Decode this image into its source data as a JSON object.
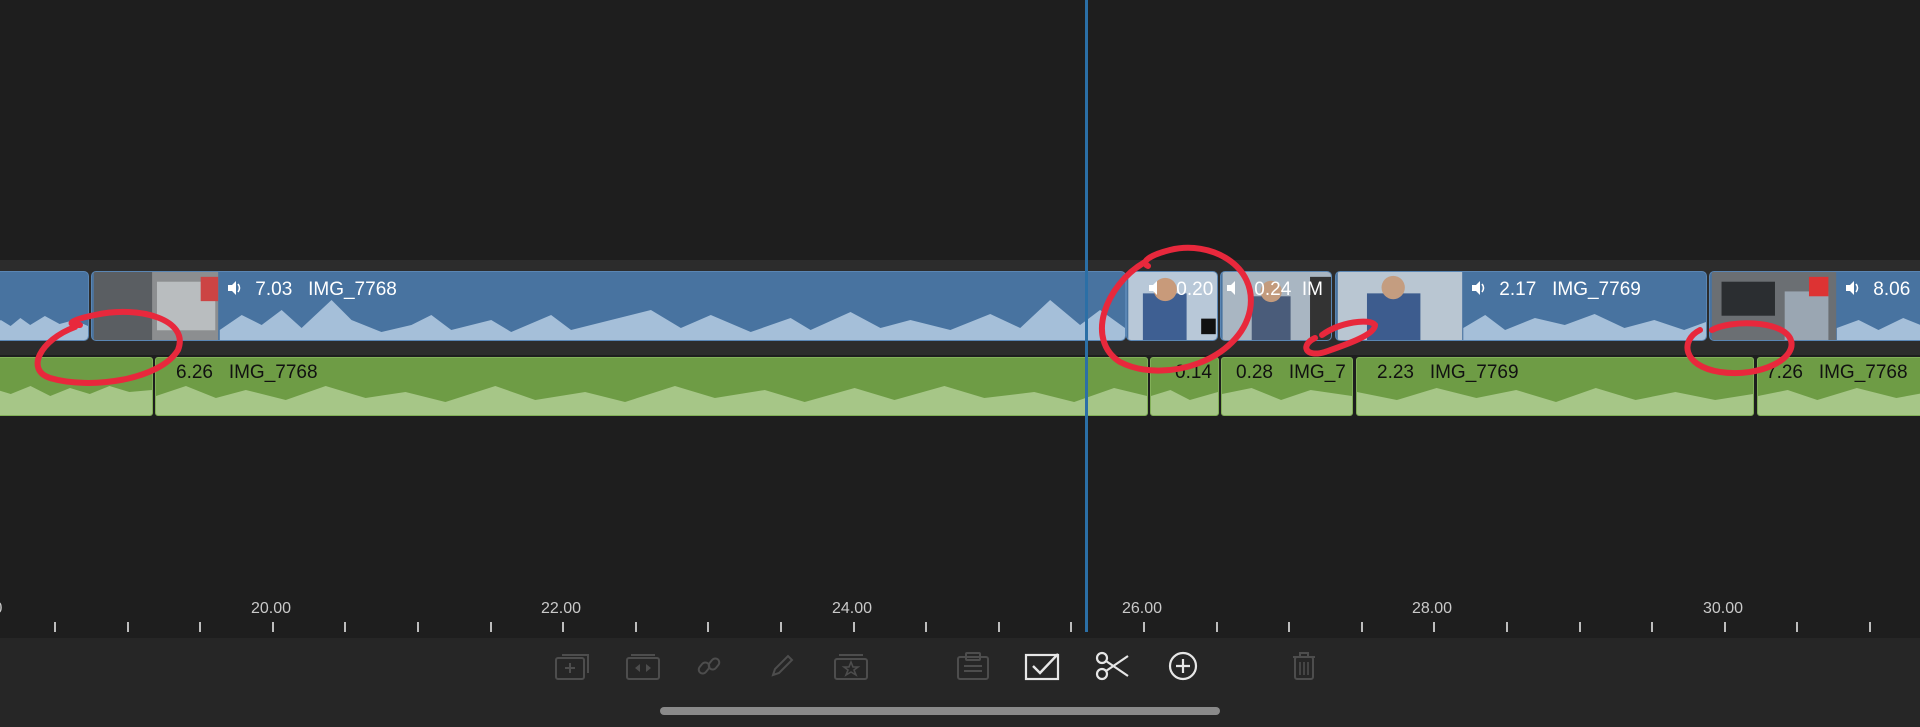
{
  "timeline": {
    "video_clips": [
      {
        "name": "",
        "duration": ""
      },
      {
        "name": "IMG_7768",
        "duration": "7.03"
      },
      {
        "name": "",
        "duration": "0.20"
      },
      {
        "name": "IM",
        "duration": "0.24"
      },
      {
        "name": "IMG_7769",
        "duration": "2.17"
      },
      {
        "name": "",
        "duration": "8.06"
      }
    ],
    "audio_clips": [
      {
        "name": "",
        "duration": ""
      },
      {
        "name": "IMG_7768",
        "duration": "6.26"
      },
      {
        "name": "",
        "duration": "0.14"
      },
      {
        "name": "IMG_7",
        "duration": "0.28"
      },
      {
        "name": "IMG_7769",
        "duration": "2.23"
      },
      {
        "name": "IMG_7768",
        "duration": "7.26"
      }
    ],
    "ruler": {
      "labels": [
        "0",
        "20.00",
        "22.00",
        "24.00",
        "26.00",
        "28.00",
        "30.00"
      ]
    }
  },
  "toolbar": {
    "tools": [
      {
        "icon": "add-clip-icon",
        "enabled": false
      },
      {
        "icon": "transition-icon",
        "enabled": false
      },
      {
        "icon": "link-icon",
        "enabled": false
      },
      {
        "icon": "pencil-icon",
        "enabled": false
      },
      {
        "icon": "favorite-icon",
        "enabled": false
      },
      {
        "icon": "paste-icon",
        "enabled": false
      },
      {
        "icon": "select-icon",
        "enabled": true
      },
      {
        "icon": "scissors-icon",
        "enabled": true
      },
      {
        "icon": "add-icon",
        "enabled": true
      },
      {
        "icon": "trash-icon",
        "enabled": false
      }
    ]
  },
  "colors": {
    "background": "#1e1e1e",
    "video_track": "#4873a0",
    "audio_track": "#6e9c45",
    "playhead": "#2b6fa6",
    "annotation": "#e8283c"
  }
}
